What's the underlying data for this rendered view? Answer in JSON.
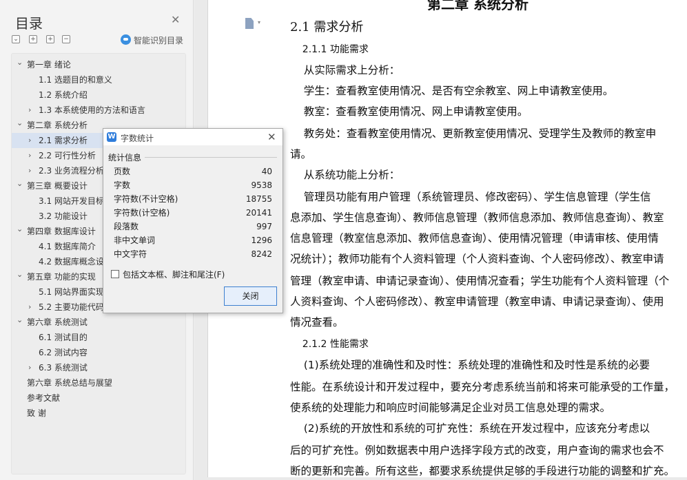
{
  "toc": {
    "title": "目录",
    "smart_label": "智能识别目录",
    "items": [
      {
        "label": "第一章  绪论",
        "level": 0,
        "arrow": "v"
      },
      {
        "label": "1.1  选题目的和意义",
        "level": 1,
        "arrow": ""
      },
      {
        "label": "1.2  系统介绍",
        "level": 1,
        "arrow": ""
      },
      {
        "label": "1.3    本系统使用的方法和语言",
        "level": 1,
        "arrow": ">"
      },
      {
        "label": "第二章  系统分析",
        "level": 0,
        "arrow": "v"
      },
      {
        "label": "2.1 需求分析",
        "level": 1,
        "arrow": ">",
        "selected": true
      },
      {
        "label": "2.2 可行性分析",
        "level": 1,
        "arrow": ">"
      },
      {
        "label": "2.3  业务流程分析",
        "level": 1,
        "arrow": ">"
      },
      {
        "label": "第三章  概要设计",
        "level": 0,
        "arrow": "v"
      },
      {
        "label": "3.1 网站开发目标",
        "level": 1,
        "arrow": ""
      },
      {
        "label": "3.2 功能设计",
        "level": 1,
        "arrow": ""
      },
      {
        "label": "第四章  数据库设计",
        "level": 0,
        "arrow": "v"
      },
      {
        "label": "4.1 数据库简介",
        "level": 1,
        "arrow": ""
      },
      {
        "label": "4.2 数据库概念设",
        "level": 1,
        "arrow": ""
      },
      {
        "label": "第五章  功能的实现",
        "level": 0,
        "arrow": "v"
      },
      {
        "label": "5.1  网站界面实现",
        "level": 1,
        "arrow": ""
      },
      {
        "label": "5.2  主要功能代码",
        "level": 1,
        "arrow": ">"
      },
      {
        "label": "第六章  系统测试",
        "level": 0,
        "arrow": "v"
      },
      {
        "label": "6.1  测试目的",
        "level": 1,
        "arrow": ""
      },
      {
        "label": "6.2  测试内容",
        "level": 1,
        "arrow": ""
      },
      {
        "label": "6.3  系统测试",
        "level": 1,
        "arrow": ">"
      },
      {
        "label": "第六章  系统总结与展望",
        "level": 0,
        "arrow": ""
      },
      {
        "label": "参考文献",
        "level": 0,
        "arrow": ""
      },
      {
        "label": "致    谢",
        "level": 0,
        "arrow": ""
      }
    ]
  },
  "document": {
    "chapter_title": "第二章  系统分析",
    "lines": [
      {
        "text": "2.1 需求分析",
        "style": "h2"
      },
      {
        "text": "    2.1.1 功能需求",
        "style": "h3"
      },
      {
        "text": "    从实际需求上分析：",
        "style": "body"
      },
      {
        "text": "    学生：查看教室使用情况、是否有空余教室、网上申请教室使用。",
        "style": "body"
      },
      {
        "text": "    教室：查看教室使用情况、网上申请教室使用。",
        "style": "body"
      },
      {
        "text": "    教务处：查看教室使用情况、更新教室使用情况、受理学生及教师的教室申",
        "style": "body"
      },
      {
        "text": "请。",
        "style": "body"
      },
      {
        "text": "    从系统功能上分析：",
        "style": "body"
      },
      {
        "text": "    管理员功能有用户管理（系统管理员、修改密码）、学生信息管理（学生信",
        "style": "body"
      },
      {
        "text": "息添加、学生信息查询）、教师信息管理（教师信息添加、教师信息查询）、教室",
        "style": "body"
      },
      {
        "text": "信息管理（教室信息添加、教师信息查询）、使用情况管理（申请审核、使用情",
        "style": "body"
      },
      {
        "text": "况统计）；教师功能有个人资料管理（个人资料查询、个人密码修改）、教室申请",
        "style": "body"
      },
      {
        "text": "管理（教室申请、申请记录查询）、使用情况查看；学生功能有个人资料管理（个",
        "style": "body"
      },
      {
        "text": "人资料查询、个人密码修改）、教室申请管理（教室申请、申请记录查询）、使用",
        "style": "body"
      },
      {
        "text": "情况查看。",
        "style": "body"
      },
      {
        "text": "    2.1.2 性能需求",
        "style": "h3"
      },
      {
        "text": "    (1)系统处理的准确性和及时性：系统处理的准确性和及时性是系统的必要",
        "style": "body"
      },
      {
        "text": "性能。在系统设计和开发过程中，要充分考虑系统当前和将来可能承受的工作量，",
        "style": "body"
      },
      {
        "text": "使系统的处理能力和响应时间能够满足企业对员工信息处理的需求。",
        "style": "body"
      },
      {
        "text": "    (2)系统的开放性和系统的可扩充性：系统在开发过程中，应该充分考虑以",
        "style": "body"
      },
      {
        "text": "后的可扩充性。例如数据表中用户选择字段方式的改变，用户查询的需求也会不",
        "style": "body"
      },
      {
        "text": "断的更新和完善。所有这些，都要求系统提供足够的手段进行功能的调整和扩充。",
        "style": "body"
      }
    ]
  },
  "dialog": {
    "title": "字数统计",
    "logo": "W",
    "heading": "统计信息",
    "stats": [
      {
        "label": "页数",
        "value": "40"
      },
      {
        "label": "字数",
        "value": "9538"
      },
      {
        "label": "字符数(不计空格)",
        "value": "18755"
      },
      {
        "label": "字符数(计空格)",
        "value": "20141"
      },
      {
        "label": "段落数",
        "value": "997"
      },
      {
        "label": "非中文单词",
        "value": "1296"
      },
      {
        "label": "中文字符",
        "value": "8242"
      }
    ],
    "include_label": "包括文本框、脚注和尾注(F)",
    "include_checked": false,
    "close_label": "关闭"
  }
}
